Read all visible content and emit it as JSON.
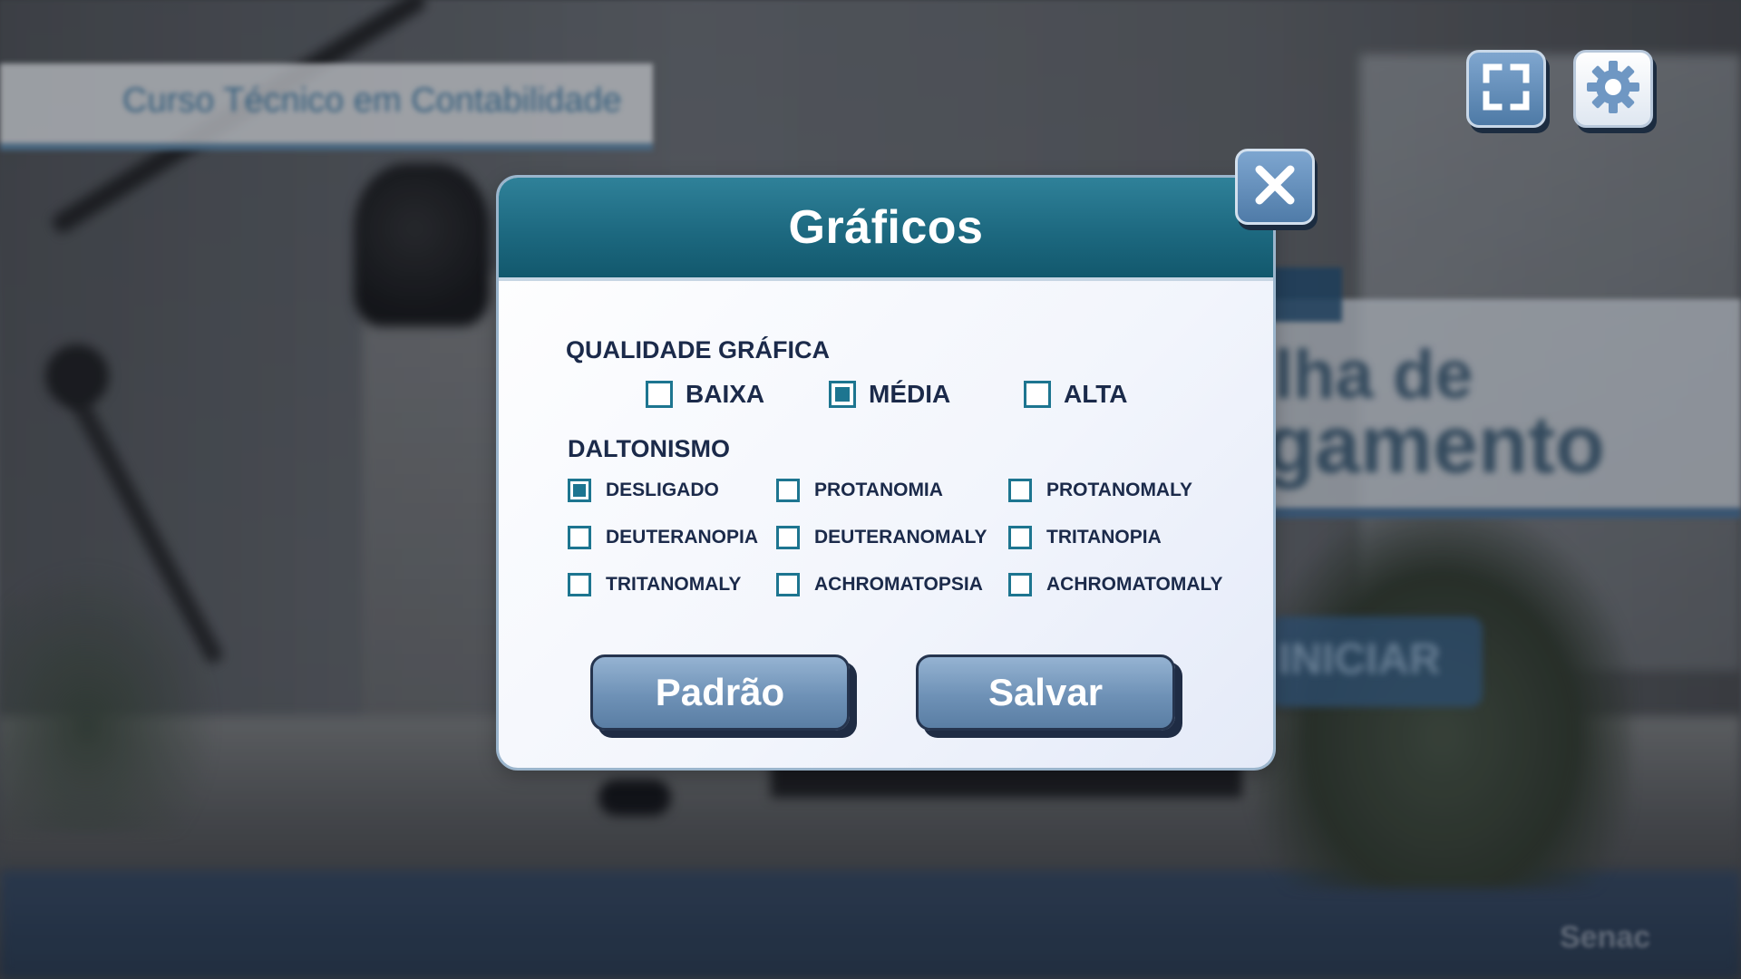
{
  "background": {
    "course_title": "Curso Técnico em Contabilidade",
    "hero_line1": "lha de",
    "hero_line2": "gamento",
    "start_label": "INICIAR",
    "brand": "Senac"
  },
  "toolbar": {
    "fullscreen_icon": "fullscreen-icon",
    "settings_icon": "gear-icon"
  },
  "dialog": {
    "title": "Gráficos",
    "close_icon": "close-icon",
    "quality": {
      "label": "QUALIDADE GRÁFICA",
      "options": [
        {
          "label": "BAIXA",
          "checked": false
        },
        {
          "label": "MÉDIA",
          "checked": true
        },
        {
          "label": "ALTA",
          "checked": false
        }
      ]
    },
    "colorblind": {
      "label": "DALTONISMO",
      "options": [
        {
          "label": "DESLIGADO",
          "checked": true
        },
        {
          "label": "PROTANOMIA",
          "checked": false
        },
        {
          "label": "PROTANOMALY",
          "checked": false
        },
        {
          "label": "DEUTERANOPIA",
          "checked": false
        },
        {
          "label": "DEUTERANOMALY",
          "checked": false
        },
        {
          "label": "TRITANOPIA",
          "checked": false
        },
        {
          "label": "TRITANOMALY",
          "checked": false
        },
        {
          "label": "ACHROMATOPSIA",
          "checked": false
        },
        {
          "label": "ACHROMATOMALY",
          "checked": false
        }
      ]
    },
    "buttons": {
      "default_label": "Padrão",
      "save_label": "Salvar"
    }
  },
  "colors": {
    "accent": "#1d7590",
    "header": "#1d6980",
    "text": "#1b2a4a",
    "button": "#6e91b6"
  }
}
